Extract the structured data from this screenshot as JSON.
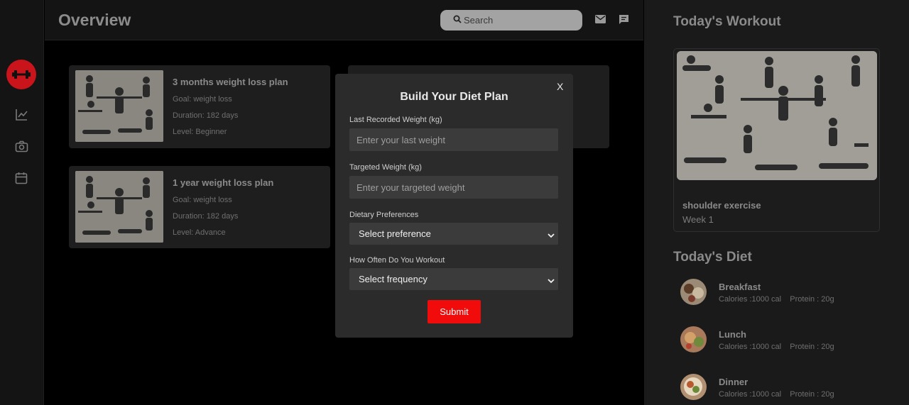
{
  "header": {
    "title": "Overview",
    "search_placeholder": "Search",
    "mail_icon": "mail-icon",
    "chat_icon": "chat-icon"
  },
  "sidebar": {
    "logo_icon": "dumbbell-icon",
    "items": [
      {
        "icon": "chart-icon"
      },
      {
        "icon": "camera-icon"
      },
      {
        "icon": "calendar-icon"
      }
    ]
  },
  "plans": [
    {
      "title": "3 months weight loss plan",
      "goal": "Goal: weight loss",
      "duration": "Duration: 182 days",
      "level": "Level: Beginner"
    },
    {
      "title": "1 year weight loss plan",
      "goal": "Goal: weight loss",
      "duration": "Duration: 182 days",
      "level": "Level: Advance"
    }
  ],
  "right": {
    "workout_title": "Today's Workout",
    "workout": {
      "name": "shoulder exercise",
      "week": "Week 1"
    },
    "diet_title": "Today's Diet",
    "diet": [
      {
        "name": "Breakfast",
        "meta": "Calories :1000 cal    Protein : 20g"
      },
      {
        "name": "Lunch",
        "meta": "Calories :1000 cal    Protein : 20g"
      },
      {
        "name": "Dinner",
        "meta": "Calories :1000 cal    Protein : 20g"
      }
    ]
  },
  "modal": {
    "title": "Build Your Diet Plan",
    "close": "X",
    "last_weight_label": "Last Recorded Weight (kg)",
    "last_weight_placeholder": "Enter your last weight",
    "target_weight_label": "Targeted Weight (kg)",
    "target_weight_placeholder": "Enter your targeted weight",
    "diet_pref_label": "Dietary Preferences",
    "diet_pref_value": "Select preference",
    "frequency_label": "How Often Do You Workout",
    "frequency_value": "Select frequency",
    "submit_label": "Submit"
  },
  "colors": {
    "accent": "#f20b0b",
    "logo_bg": "#c8141a",
    "modal_bg": "#2b2b2b"
  }
}
